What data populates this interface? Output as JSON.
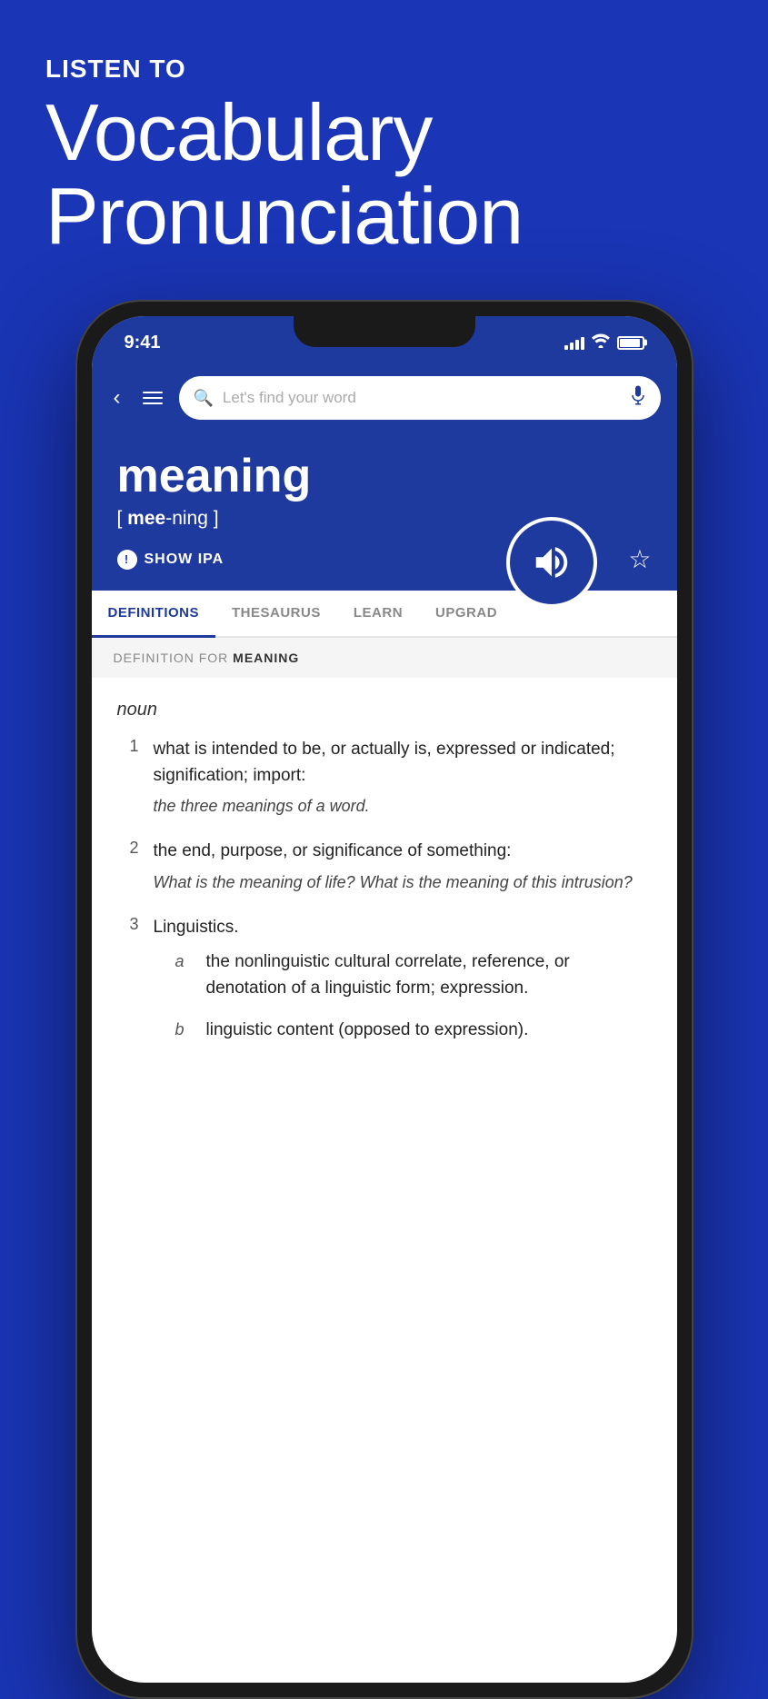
{
  "hero": {
    "listen_to": "LISTEN TO",
    "title_line1": "Vocabulary",
    "title_line2": "Pronunciation"
  },
  "status_bar": {
    "time": "9:41"
  },
  "search": {
    "placeholder": "Let's find your word"
  },
  "word": {
    "text": "meaning",
    "pronunciation": "[ mee-ning ]",
    "pronunciation_bold": "mee",
    "show_ipa_label": "SHOW IPA"
  },
  "tabs": [
    {
      "label": "DEFINITIONS",
      "active": true
    },
    {
      "label": "THESAURUS",
      "active": false
    },
    {
      "label": "LEARN",
      "active": false
    },
    {
      "label": "UPGRAD",
      "active": false
    }
  ],
  "definition_header": {
    "prefix": "DEFINITION FOR ",
    "word": "MEANING"
  },
  "definitions": {
    "pos": "noun",
    "items": [
      {
        "number": "1",
        "text": "what is intended to be, or actually is, expressed or indicated; signification; import:",
        "example": "the three meanings of a word."
      },
      {
        "number": "2",
        "text": "the end, purpose, or significance of something:",
        "example": "What is the meaning of life? What is the meaning of this intrusion?"
      },
      {
        "number": "3",
        "text": "Linguistics.",
        "example": null
      }
    ],
    "sub_items": [
      {
        "letter": "a",
        "text": "the nonlinguistic cultural correlate, reference, or denotation of a linguistic form; expression.",
        "example": null
      },
      {
        "letter": "b",
        "text": "linguistic content (opposed to expression).",
        "example": null
      }
    ]
  }
}
